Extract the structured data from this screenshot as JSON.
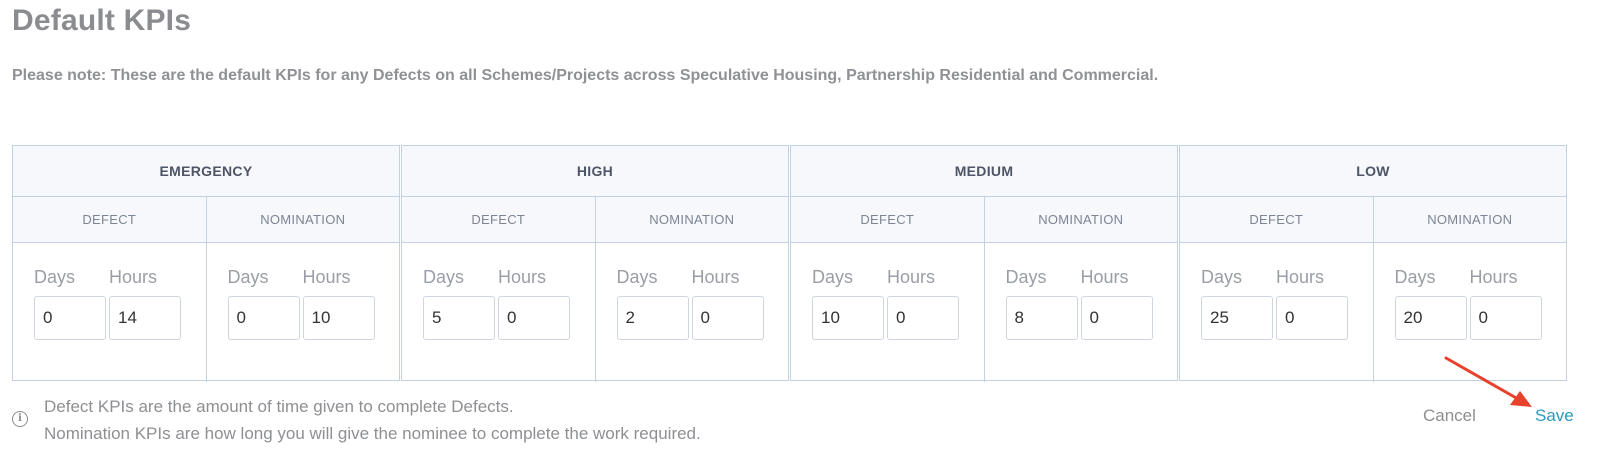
{
  "page": {
    "title": "Default KPIs",
    "note": "Please note: These are the default KPIs for any Defects on all Schemes/Projects across Speculative Housing, Partnership Residential and Commercial."
  },
  "kpis": [
    {
      "priority": "EMERGENCY",
      "defect": {
        "label": "DEFECT",
        "days_label": "Days",
        "hours_label": "Hours",
        "days": "0",
        "hours": "14"
      },
      "nomination": {
        "label": "NOMINATION",
        "days_label": "Days",
        "hours_label": "Hours",
        "days": "0",
        "hours": "10"
      }
    },
    {
      "priority": "HIGH",
      "defect": {
        "label": "DEFECT",
        "days_label": "Days",
        "hours_label": "Hours",
        "days": "5",
        "hours": "0"
      },
      "nomination": {
        "label": "NOMINATION",
        "days_label": "Days",
        "hours_label": "Hours",
        "days": "2",
        "hours": "0"
      }
    },
    {
      "priority": "MEDIUM",
      "defect": {
        "label": "DEFECT",
        "days_label": "Days",
        "hours_label": "Hours",
        "days": "10",
        "hours": "0"
      },
      "nomination": {
        "label": "NOMINATION",
        "days_label": "Days",
        "hours_label": "Hours",
        "days": "8",
        "hours": "0"
      }
    },
    {
      "priority": "LOW",
      "defect": {
        "label": "DEFECT",
        "days_label": "Days",
        "hours_label": "Hours",
        "days": "25",
        "hours": "0"
      },
      "nomination": {
        "label": "NOMINATION",
        "days_label": "Days",
        "hours_label": "Hours",
        "days": "20",
        "hours": "0"
      }
    }
  ],
  "footer": {
    "info_icon": "info-icon",
    "line1": "Defect KPIs are the amount of time given to complete Defects.",
    "line2": "Nomination KPIs are how long you will give the nominee to complete the work required.",
    "cancel_label": "Cancel",
    "save_label": "Save"
  },
  "colors": {
    "accent": "#2a9ab8",
    "annotation_arrow": "#e8412c",
    "border": "#c3d2e3"
  }
}
